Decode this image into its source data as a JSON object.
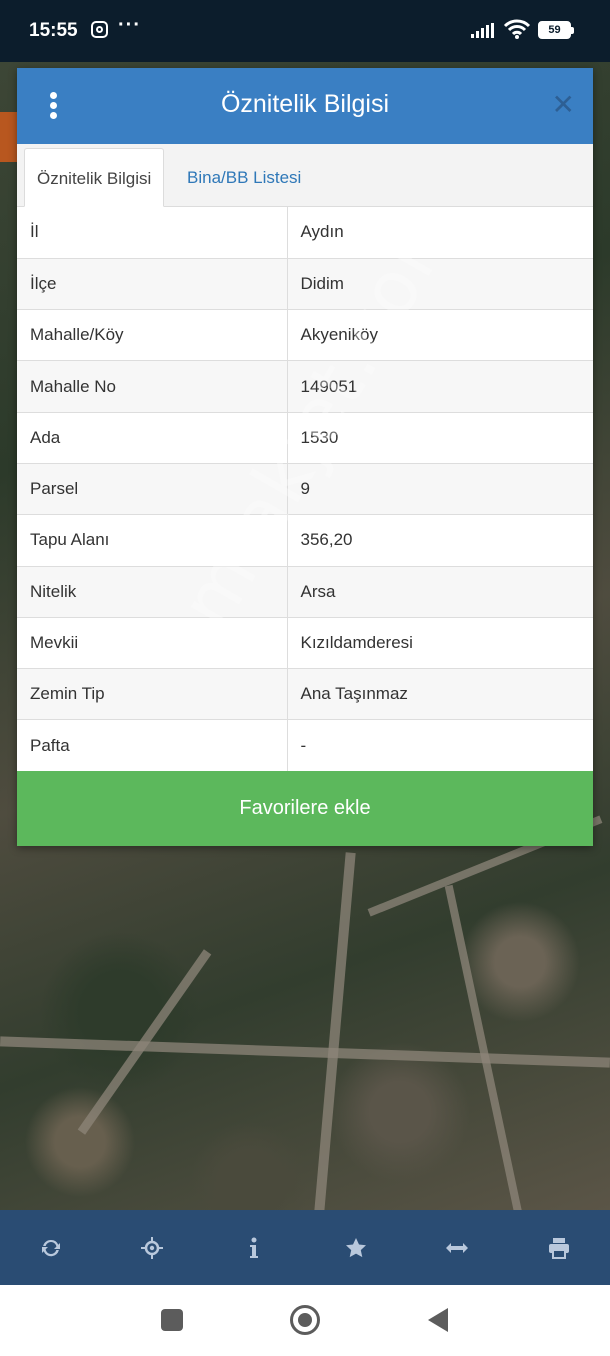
{
  "status_bar": {
    "time": "15:55",
    "battery": "59"
  },
  "dialog": {
    "title": "Öznitelik Bilgisi",
    "tabs": [
      {
        "label": "Öznitelik Bilgisi",
        "active": true
      },
      {
        "label": "Bina/BB Listesi",
        "active": false
      }
    ],
    "rows": [
      {
        "key": "İl",
        "value": "Aydın"
      },
      {
        "key": "İlçe",
        "value": "Didim"
      },
      {
        "key": "Mahalle/Köy",
        "value": "Akyeniköy"
      },
      {
        "key": "Mahalle No",
        "value": "149051"
      },
      {
        "key": "Ada",
        "value": "1530"
      },
      {
        "key": "Parsel",
        "value": "9"
      },
      {
        "key": "Tapu Alanı",
        "value": "356,20"
      },
      {
        "key": "Nitelik",
        "value": "Arsa"
      },
      {
        "key": "Mevkii",
        "value": "Kızıldamderesi"
      },
      {
        "key": "Zemin Tip",
        "value": "Ana Taşınmaz"
      },
      {
        "key": "Pafta",
        "value": "-"
      }
    ],
    "favorite_button": "Favorilere ekle"
  },
  "watermark": "emlakjet.com",
  "toolbar": {
    "icons": [
      "refresh-icon",
      "locate-icon",
      "info-icon",
      "star-icon",
      "measure-icon",
      "print-icon"
    ]
  },
  "colors": {
    "header": "#3a7fc3",
    "favorite": "#5cb85c",
    "toolbar": "#2a4c73"
  }
}
